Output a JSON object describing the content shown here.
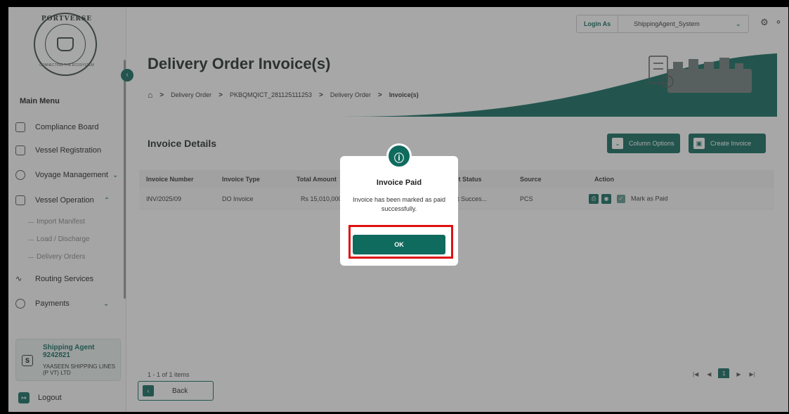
{
  "logo": {
    "text": "PORTVERSE",
    "tagline": "CONNECTING THE ECOSYSTEM"
  },
  "sidebar": {
    "menu_title": "Main Menu",
    "items": [
      {
        "label": "Compliance Board",
        "icon": "clipboard-icon"
      },
      {
        "label": "Vessel Registration",
        "icon": "ship-icon"
      },
      {
        "label": "Voyage Management",
        "icon": "compass-icon"
      },
      {
        "label": "Vessel Operation",
        "icon": "vessel-icon"
      },
      {
        "label": "Routing Services",
        "icon": "route-icon"
      },
      {
        "label": "Payments",
        "icon": "payment-icon"
      }
    ],
    "sub_items": [
      "Import Manifest",
      "Load / Discharge",
      "Delivery Orders"
    ],
    "user": {
      "initial": "S",
      "name": "Shipping Agent 9242821",
      "company": "YAASEEN SHIPPING LINES (P VT) LTD"
    },
    "logout": "Logout"
  },
  "topbar": {
    "login_as": "Login As",
    "login_value": "ShippingAgent_System"
  },
  "header": {
    "title": "Delivery Order Invoice(s)",
    "breadcrumb": [
      "Delivery Order",
      "PKBQMQICT_281125111253",
      "Delivery Order",
      "Invoice(s)"
    ]
  },
  "section": {
    "title": "Invoice Details",
    "column_options": "Column Options",
    "create_invoice": "Create Invoice"
  },
  "table": {
    "headers": [
      "Invoice Number",
      "Invoice Type",
      "Total Amount",
      "Payment Status",
      "Source",
      "Action"
    ],
    "rows": [
      {
        "invoice_number": "INV/2025/09",
        "invoice_type": "DO Invoice",
        "total_amount": "Rs 15,010,000",
        "payment_status": "Payment Succes...",
        "source": "PCS",
        "action_label": "Mark as Paid"
      }
    ]
  },
  "pagination": {
    "info": "1 - 1 of 1 items",
    "current_page": "1"
  },
  "footer": {
    "back": "Back"
  },
  "modal": {
    "title": "Invoice Paid",
    "message": "Invoice has been marked as paid successfully.",
    "ok": "OK"
  },
  "colors": {
    "brand": "#0f6b5e",
    "highlight": "#e01010"
  }
}
